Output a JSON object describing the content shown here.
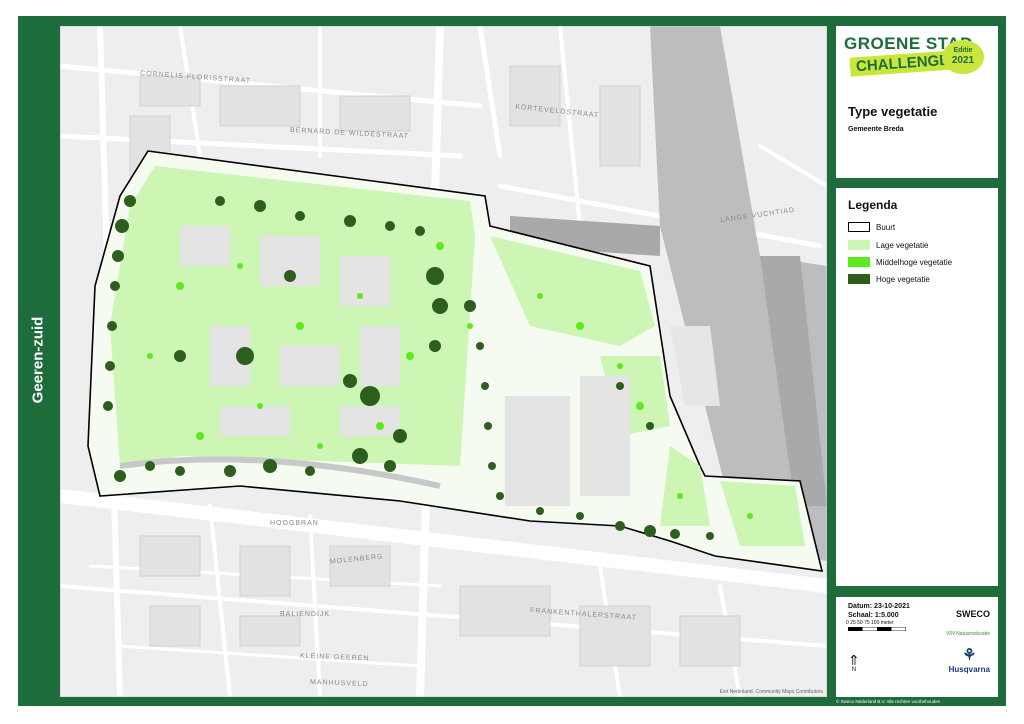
{
  "side_label": "Geeren-zuid",
  "logo": {
    "line1": "GROENE STAD",
    "line2": "CHALLENGE",
    "edition_label": "Editie",
    "edition_year": "2021"
  },
  "title": "Type vegetatie",
  "subtitle": "Gemeente Breda",
  "legend": {
    "title": "Legenda",
    "items": [
      {
        "label": "Buurt",
        "color": "#ffffff",
        "border": "#000000"
      },
      {
        "label": "Lage vegetatie",
        "color": "#cdf5b4"
      },
      {
        "label": "Middelhoge vegetatie",
        "color": "#5ee81e"
      },
      {
        "label": "Hoge vegetatie",
        "color": "#2d5e1e"
      }
    ]
  },
  "info": {
    "date": "Datum: 23-10-2021",
    "scale": "Schaal: 1:5.000",
    "scale_ticks": "0  25  50  75  100",
    "scale_unit": "meter",
    "north_letter": "N",
    "sweco": "SWECO",
    "ivn": "IVN Natuureducatie",
    "husqvarna": "Husqvarna",
    "footer": "© Sweco Nederland B.V. Alle rechten voorbehouden"
  },
  "map": {
    "attribution": "Esri Nederland, Community Maps Contributors",
    "streets": [
      "CORNELIS FLORISSTRAAT",
      "BERNARD DE WILDESTRAAT",
      "KORTEVELDSTRAAT",
      "LANGE VUCHTIAD",
      "HOOGBRAN",
      "MOLENBERG",
      "BALIENDIJK",
      "FRANKENTHALERSTRAAT",
      "KLEINE GEEREN",
      "MANHUSVELD"
    ]
  }
}
